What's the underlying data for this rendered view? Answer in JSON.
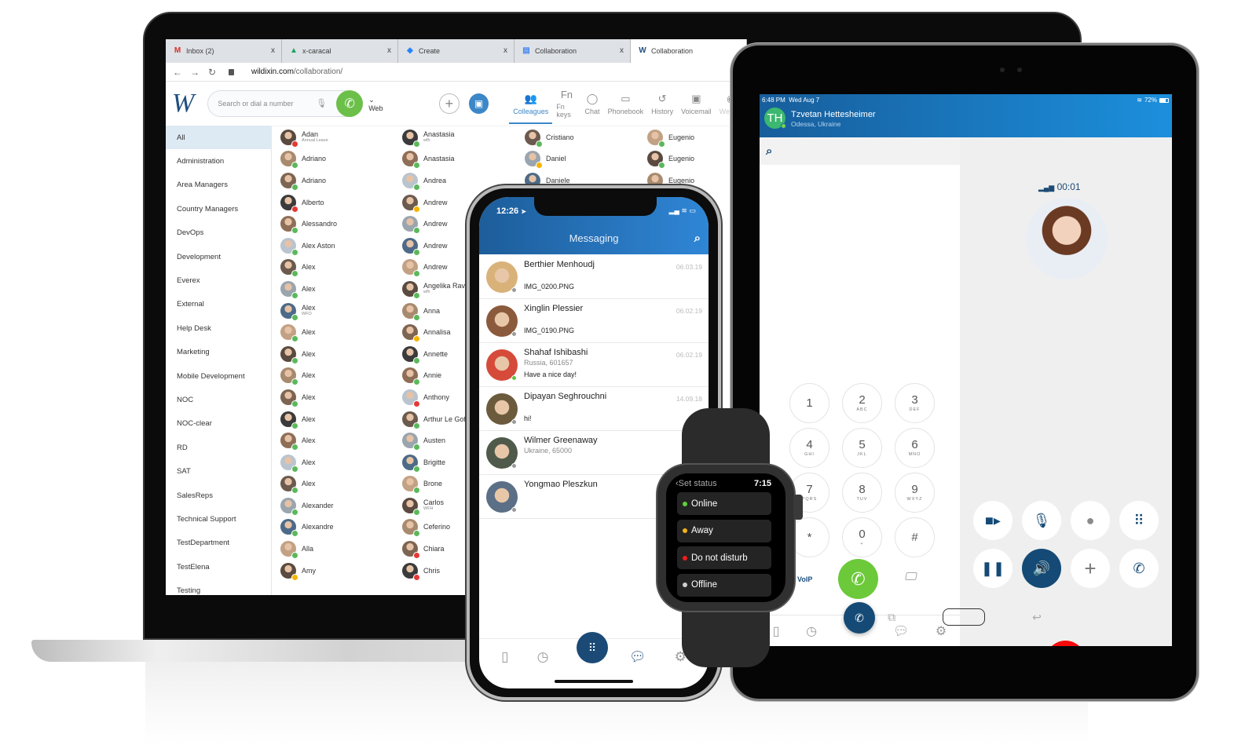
{
  "laptop": {
    "browser": {
      "tabs": [
        {
          "icon": "gmail-icon",
          "glyph": "M",
          "color": "#d93025",
          "label": "Inbox (2)",
          "active": false
        },
        {
          "icon": "google-drive-icon",
          "glyph": "▲",
          "color": "#1fa463",
          "label": "x-caracal",
          "active": false
        },
        {
          "icon": "jira-icon",
          "glyph": "◆",
          "color": "#2684ff",
          "label": "Create",
          "active": false
        },
        {
          "icon": "google-docs-icon",
          "glyph": "▤",
          "color": "#4285f4",
          "label": "Collaboration",
          "active": false
        },
        {
          "icon": "wildix-icon",
          "glyph": "W",
          "color": "#1f4f80",
          "label": "Collaboration",
          "active": true
        }
      ],
      "close_glyph": "x",
      "url_host": "wildixin.com",
      "url_path": "/collaboration/"
    },
    "app": {
      "logo": "W",
      "search_placeholder": "Search or dial a number",
      "device_selector": "Web",
      "nav_tabs": [
        {
          "icon": "colleagues-icon",
          "glyph": "👥",
          "label": "Colleagues",
          "active": true
        },
        {
          "icon": "fn-keys-icon",
          "glyph": "Fn",
          "label": "Fn keys"
        },
        {
          "icon": "chat-icon",
          "glyph": "◯",
          "label": "Chat"
        },
        {
          "icon": "phonebook-icon",
          "glyph": "▭",
          "label": "Phonebook"
        },
        {
          "icon": "history-icon",
          "glyph": "↺",
          "label": "History"
        },
        {
          "icon": "voicemail-icon",
          "glyph": "▣",
          "label": "Voicemail"
        },
        {
          "icon": "webinar-icon",
          "glyph": "◉",
          "label": "Webina",
          "faded": true
        }
      ],
      "groups": [
        "All",
        "Administration",
        "Area Managers",
        "Country Managers",
        "DevOps",
        "Development",
        "Everex",
        "External",
        "Help Desk",
        "Marketing",
        "Mobile Development",
        "NOC",
        "NOC-clear",
        "RD",
        "SAT",
        "SalesReps",
        "Technical Support",
        "TestDepartment",
        "TestElena",
        "Testing"
      ],
      "active_group": "All",
      "colleagues_columns": [
        [
          {
            "name": "Adan",
            "note": "Annual Leave",
            "status": "red"
          },
          {
            "name": "Adriano",
            "status": "green"
          },
          {
            "name": "Adriano",
            "status": "green"
          },
          {
            "name": "Alberto",
            "status": "red"
          },
          {
            "name": "Alessandro",
            "status": "green"
          },
          {
            "name": "Alex Aston",
            "status": "green"
          },
          {
            "name": "Alex",
            "status": "green"
          },
          {
            "name": "Alex",
            "status": "green"
          },
          {
            "name": "Alex",
            "note": "WFO",
            "status": "green"
          },
          {
            "name": "Alex",
            "status": "green"
          },
          {
            "name": "Alex",
            "status": "green"
          },
          {
            "name": "Alex",
            "status": "green"
          },
          {
            "name": "Alex",
            "status": "green"
          },
          {
            "name": "Alex",
            "status": "green"
          },
          {
            "name": "Alex",
            "status": "green"
          },
          {
            "name": "Alex",
            "status": "green"
          },
          {
            "name": "Alex",
            "status": "green"
          },
          {
            "name": "Alexander",
            "status": "green"
          },
          {
            "name": "Alexandre",
            "status": "green"
          },
          {
            "name": "Alla",
            "status": "green"
          },
          {
            "name": "Amy",
            "status": "yellow"
          }
        ],
        [
          {
            "name": "Anastasia",
            "note": "wfh",
            "status": "green"
          },
          {
            "name": "Anastasia",
            "status": "green"
          },
          {
            "name": "Andrea",
            "status": "green"
          },
          {
            "name": "Andrew",
            "status": "yellow"
          },
          {
            "name": "Andrew",
            "status": "green"
          },
          {
            "name": "Andrew",
            "status": "green"
          },
          {
            "name": "Andrew",
            "status": "green"
          },
          {
            "name": "Angelika Rav",
            "note": "wfh",
            "status": "green"
          },
          {
            "name": "Anna",
            "status": "green"
          },
          {
            "name": "Annalisa",
            "status": "yellow"
          },
          {
            "name": "Annette",
            "status": "green"
          },
          {
            "name": "Annie",
            "status": "green"
          },
          {
            "name": "Anthony",
            "status": "call"
          },
          {
            "name": "Arthur Le Gof",
            "status": "green"
          },
          {
            "name": "Austen",
            "status": "green"
          },
          {
            "name": "Brigitte",
            "status": "green"
          },
          {
            "name": "Brone",
            "status": "green"
          },
          {
            "name": "Carlos",
            "note": "WFH",
            "status": "green"
          },
          {
            "name": "Ceferino",
            "status": "green"
          },
          {
            "name": "Chiara",
            "status": "red"
          },
          {
            "name": "Chris",
            "status": "red"
          }
        ],
        [
          {
            "name": "Cristiano",
            "status": "green"
          },
          {
            "name": "Daniel",
            "status": "yellow"
          },
          {
            "name": "Daniele",
            "status": "green"
          }
        ],
        [
          {
            "name": "Eugenio",
            "status": "green"
          },
          {
            "name": "Eugenio",
            "status": "green"
          },
          {
            "name": "Eugenio",
            "status": "green"
          }
        ]
      ]
    }
  },
  "phone": {
    "time": "12:26",
    "title": "Messaging",
    "messages": [
      {
        "name": "Berthier Menhoudj",
        "sub": "",
        "text": "IMG_0200.PNG",
        "date": "06.03.19",
        "status": "gray",
        "avatar": "#d9b27a"
      },
      {
        "name": "Xinglin Plessier",
        "sub": "",
        "text": "IMG_0190.PNG",
        "date": "06.02.19",
        "status": "gray",
        "avatar": "#8b5a3c"
      },
      {
        "name": "Shahaf Ishibashi",
        "sub": "Russia, 601657",
        "text": "Have a nice day!",
        "date": "06.02.19",
        "status": "green",
        "avatar": "#d64a3a"
      },
      {
        "name": "Dipayan Seghrouchni",
        "sub": "",
        "text": "hi!",
        "date": "14.09.18",
        "status": "gray",
        "avatar": "#6b5a3c"
      },
      {
        "name": "Wilmer Greenaway",
        "sub": "Ukraine, 65000",
        "text": "",
        "date": "",
        "status": "gray",
        "avatar": "#4f5a4a"
      },
      {
        "name": "Yongmao Pleszkun",
        "sub": "",
        "text": "",
        "date": "",
        "status": "gray",
        "avatar": "#5b6f86"
      }
    ],
    "bottom_nav": [
      "phonebook-icon",
      "history-icon",
      "dialpad-icon",
      "chat-icon",
      "settings-icon"
    ]
  },
  "watch": {
    "title": "Set status",
    "time": "7:15",
    "options": [
      {
        "label": "Online",
        "color": "#5fd13a"
      },
      {
        "label": "Away",
        "color": "#f3b01c"
      },
      {
        "label": "Do not disturb",
        "color": "#f01c1c"
      },
      {
        "label": "Offline",
        "color": "#cfcfcf"
      }
    ]
  },
  "tablet": {
    "status_time": "6:48 PM",
    "status_date": "Wed Aug 7",
    "battery": "72%",
    "battery_level": 0.72,
    "contact_initials": "TH",
    "contact_name": "Tzvetan Hettesheimer",
    "contact_location": "Odessa, Ukraine",
    "call_timer": "00:01",
    "keypad": [
      {
        "d": "1",
        "l": ""
      },
      {
        "d": "2",
        "l": "ABC"
      },
      {
        "d": "3",
        "l": "DEF"
      },
      {
        "d": "4",
        "l": "GHI"
      },
      {
        "d": "5",
        "l": "JKL"
      },
      {
        "d": "6",
        "l": "MNO"
      },
      {
        "d": "7",
        "l": "PQRS"
      },
      {
        "d": "8",
        "l": "TUV"
      },
      {
        "d": "9",
        "l": "WXYZ"
      },
      {
        "d": "*",
        "l": ""
      },
      {
        "d": "0",
        "l": "+"
      },
      {
        "d": "#",
        "l": ""
      }
    ],
    "line_label": "VoIP",
    "call_controls": [
      {
        "name": "video-button",
        "glyph": "■▸",
        "on": false
      },
      {
        "name": "mute-button",
        "glyph": "🎙",
        "on": false
      },
      {
        "name": "record-button",
        "glyph": "●",
        "on": false
      },
      {
        "name": "dialpad-button",
        "glyph": "⠿",
        "on": false
      },
      {
        "name": "hold-button",
        "glyph": "❚❚",
        "on": false
      },
      {
        "name": "speaker-button",
        "glyph": "🔊",
        "on": true
      },
      {
        "name": "add-call-button",
        "glyph": "+",
        "on": false
      },
      {
        "name": "transfer-button",
        "glyph": "✆",
        "on": false
      }
    ]
  },
  "colors": {
    "brand_blue": "#1b4a76",
    "accent_blue": "#3b87c8",
    "green": "#6cc04a",
    "status_green": "#5cb85c",
    "status_red": "#e53935",
    "status_yellow": "#f4b400",
    "hangup_red": "#f50b0b"
  }
}
